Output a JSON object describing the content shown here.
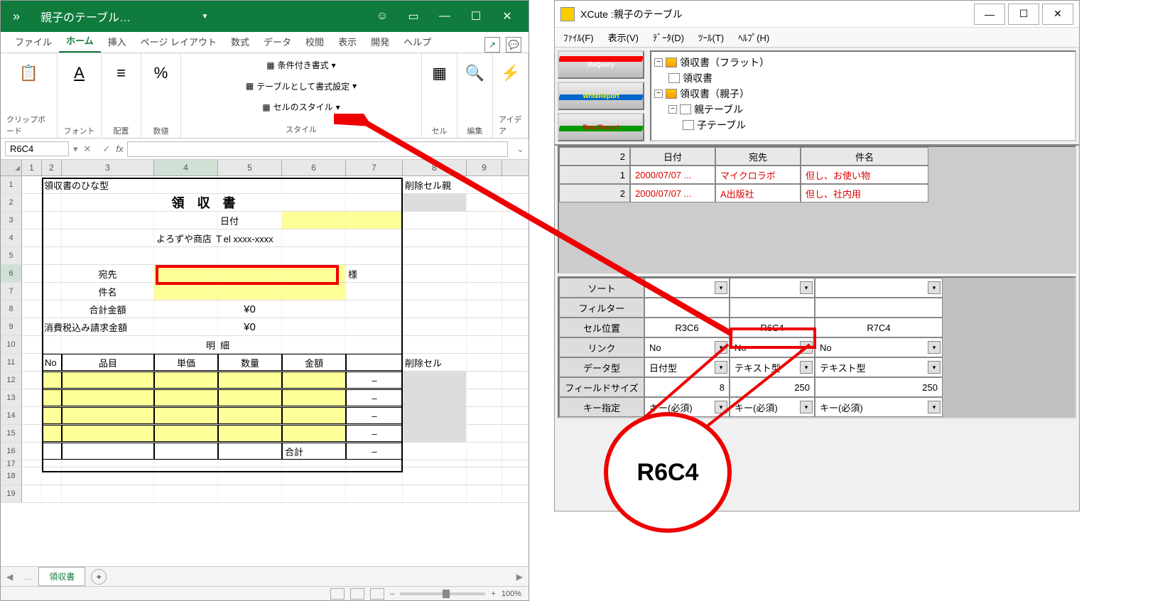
{
  "excel": {
    "title": "親子のテーブル…",
    "tabs": [
      "ファイル",
      "ホーム",
      "挿入",
      "ページ レイアウト",
      "数式",
      "データ",
      "校閲",
      "表示",
      "開発",
      "ヘルプ"
    ],
    "active_tab": "ホーム",
    "groups": {
      "clipboard": "クリップボード",
      "font": "フォント",
      "align": "配置",
      "number": "数値",
      "style_head": "スタイル",
      "cells": "セル",
      "editing": "編集",
      "ideas": "アイデア",
      "cond": "条件付き書式",
      "table": "テーブルとして書式設定",
      "cellstyle": "セルのスタイル"
    },
    "namebox": "R6C4",
    "fx_label": "fx",
    "columns": [
      "1",
      "2",
      "3",
      "4",
      "5",
      "6",
      "7",
      "8",
      "9"
    ],
    "rows_count": 19,
    "sheet": {
      "hina": "領収書のひな型",
      "del_parent": "削除セル親",
      "title": "領　収　書",
      "date_label": "日付",
      "shop": "よろずや商店 Ｔel xxxx-xxxx",
      "atesaki_label": "宛先",
      "sama": "様",
      "kenmei_label": "件名",
      "goukei_label": "合計金額",
      "goukei_val": "¥0",
      "zei_label": "消費税込み請求金額",
      "zei_val": "¥0",
      "meisai_l": "明",
      "meisai_r": "細",
      "h_no": "No",
      "h_hinmoku": "品目",
      "h_tanka": "単価",
      "h_suuryou": "数量",
      "h_kingaku": "金額",
      "h_del": "削除セル",
      "row_dash": "–",
      "footer_goukei": "合計"
    },
    "sheettab": "領収書",
    "zoom": "100%"
  },
  "xcute": {
    "title": "XCute :親子のテーブル",
    "menu": [
      "ﾌｧｲﾙ(F)",
      "表示(V)",
      "ﾃﾞｰﾀ(D)",
      "ﾂｰﾙ(T)",
      "ﾍﾙﾌﾟ(H)"
    ],
    "tool_buttons": [
      "ReQuery",
      "WriteReport",
      "ReadReport"
    ],
    "tree": {
      "n1": "領収書（フラット）",
      "n1a": "領収書",
      "n2": "領収書（親子）",
      "n2a": "親テーブル",
      "n2b": "子テーブル"
    },
    "grid": {
      "count": "2",
      "headers": [
        "日付",
        "宛先",
        "件名"
      ],
      "rows": [
        {
          "idx": "1",
          "date": "2000/07/07 ...",
          "to": "マイクロラボ",
          "subj": "但し、お使い物"
        },
        {
          "idx": "2",
          "date": "2000/07/07 ...",
          "to": "A出版社",
          "subj": "但し、社内用"
        }
      ]
    },
    "props": {
      "labels": {
        "sort": "ソート",
        "filter": "フィルター",
        "cellpos": "セル位置",
        "link": "リンク",
        "dtype": "データ型",
        "fsize": "フィールドサイズ",
        "key": "キー指定"
      },
      "cols": [
        {
          "cellpos": "R3C6",
          "link": "No",
          "dtype": "日付型",
          "fsize": "8",
          "key": "キー(必須)"
        },
        {
          "cellpos": "R6C4",
          "link": "No",
          "dtype": "テキスト型",
          "fsize": "250",
          "key": "キー(必須)"
        },
        {
          "cellpos": "R7C4",
          "link": "No",
          "dtype": "テキスト型",
          "fsize": "250",
          "key": "キー(必須)"
        }
      ]
    }
  },
  "callout": "R6C4"
}
